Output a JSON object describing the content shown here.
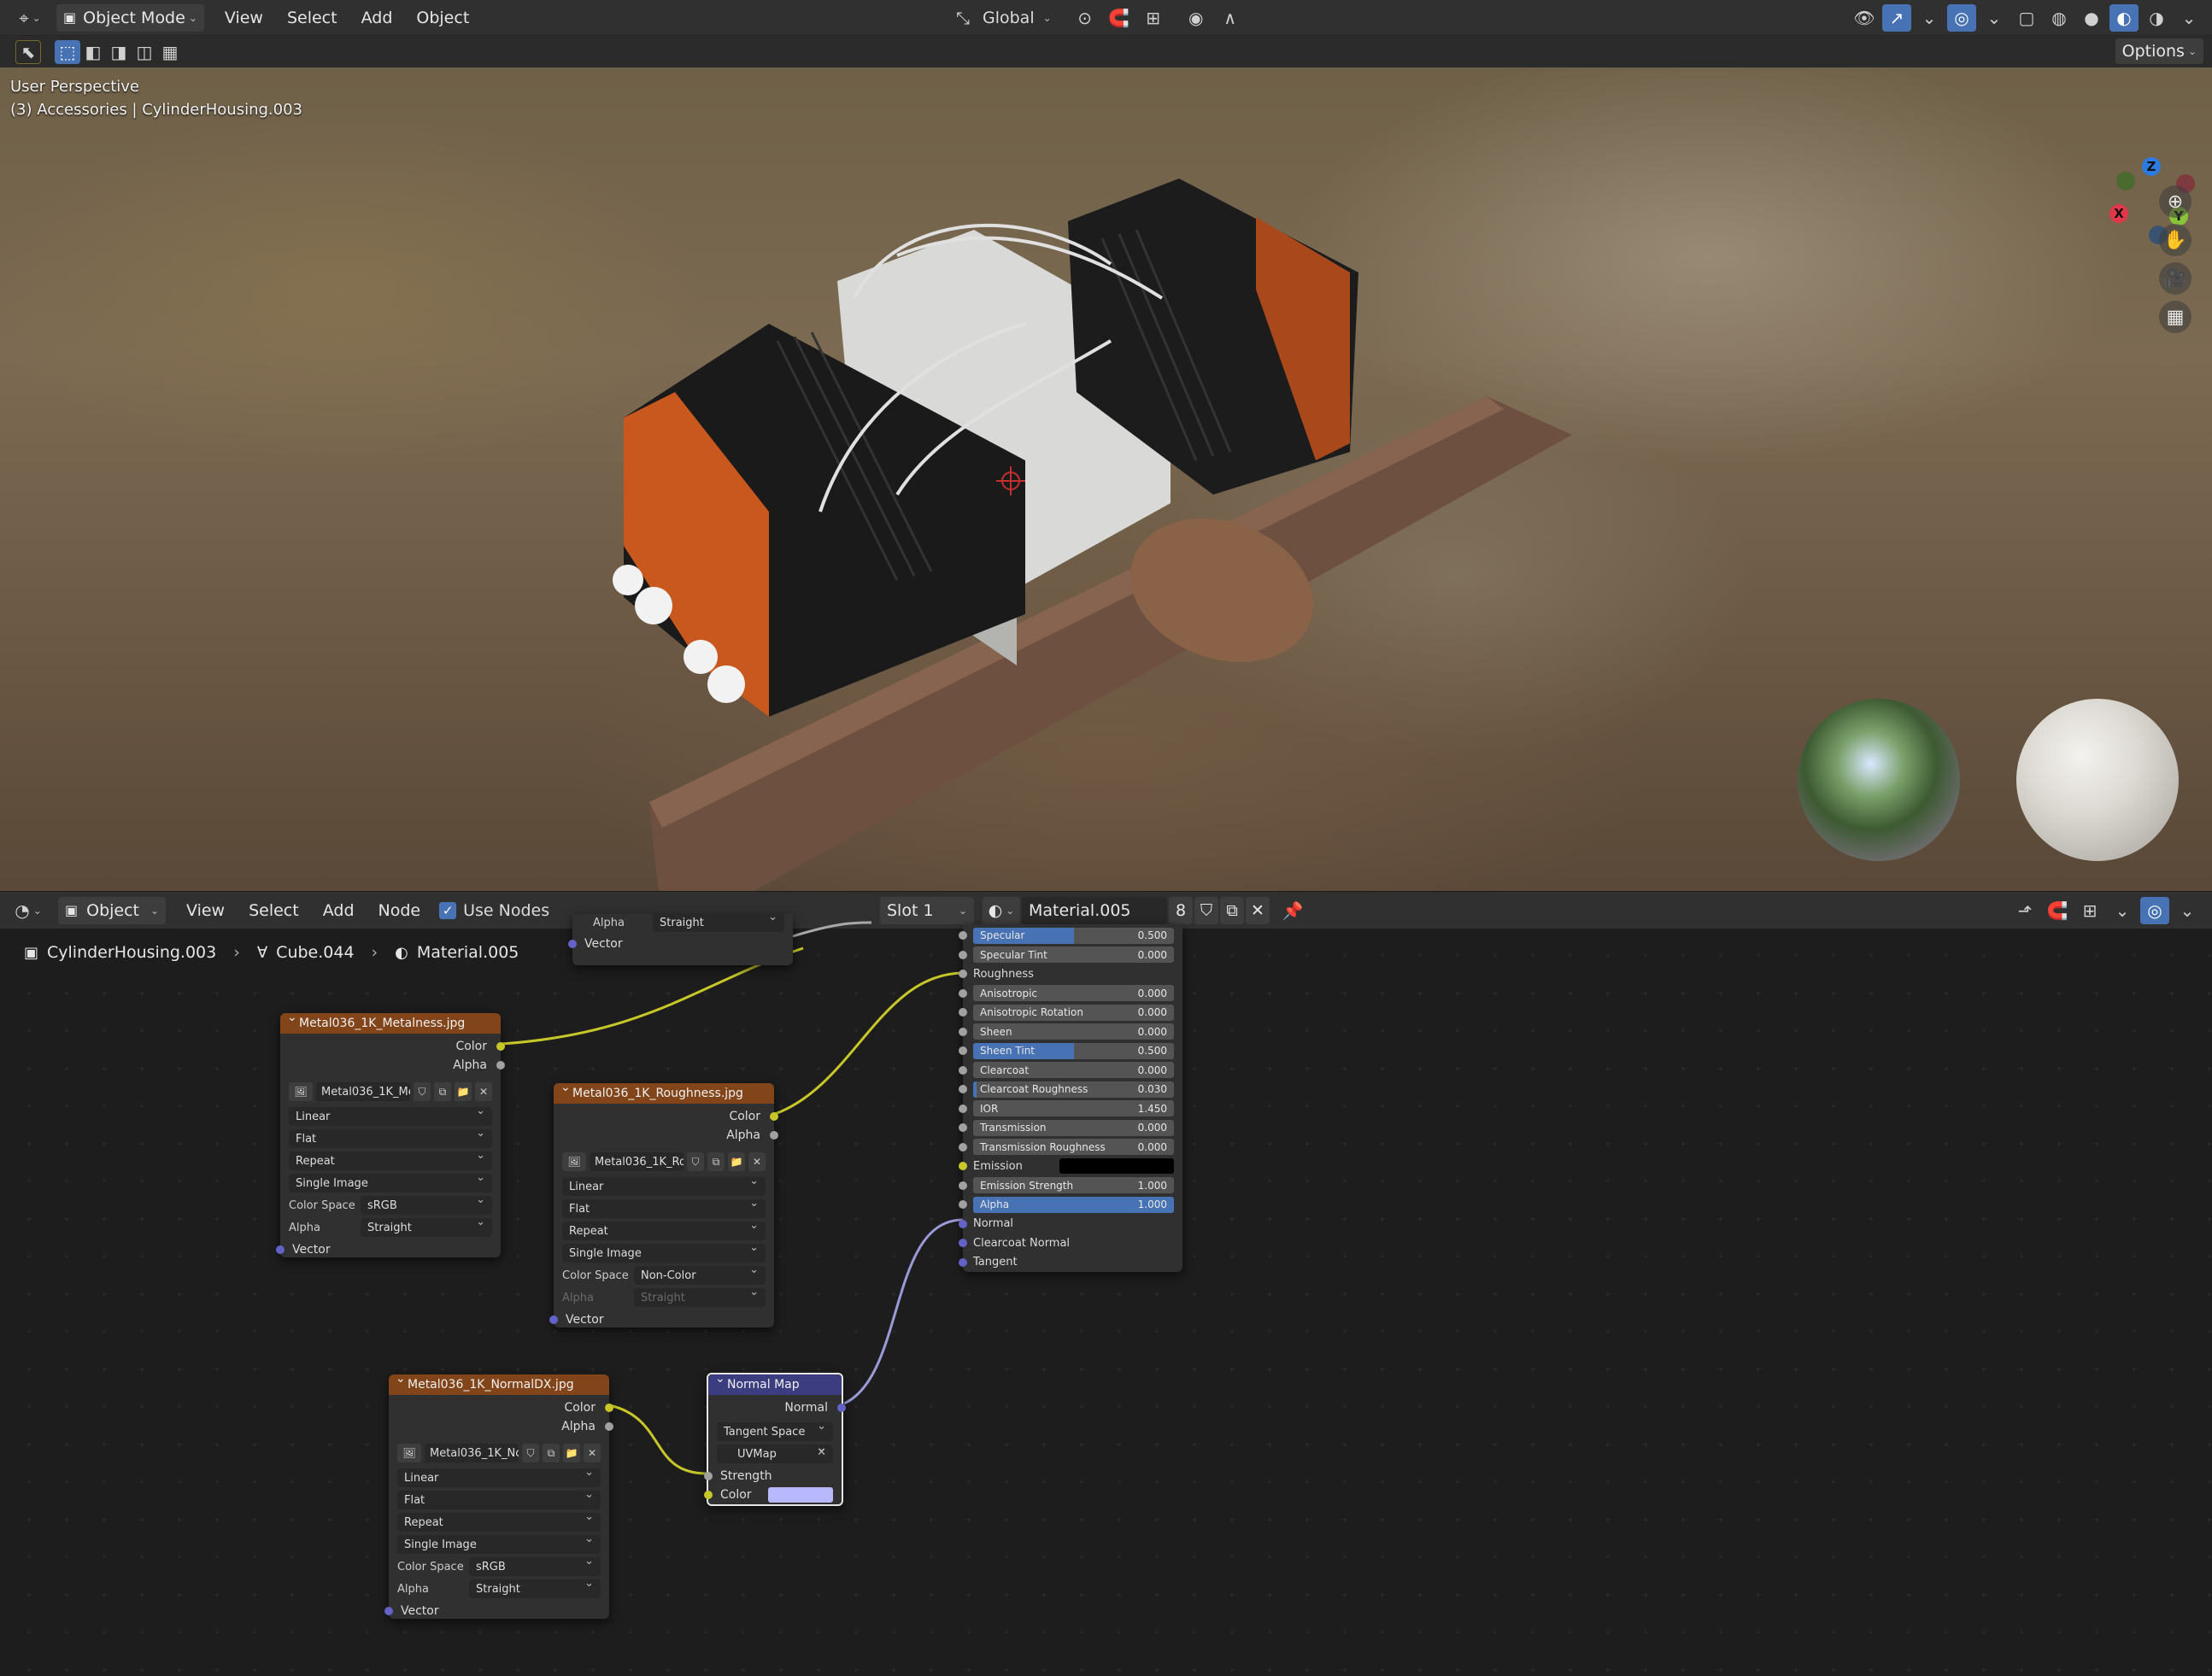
{
  "viewport_header": {
    "mode": "Object Mode",
    "menus": [
      "View",
      "Select",
      "Add",
      "Object"
    ],
    "transform_orientation": "Global",
    "options_label": "Options"
  },
  "viewport": {
    "perspective_label": "User Perspective",
    "object_info": "(3) Accessories | CylinderHousing.003",
    "gizmo": {
      "x": "X",
      "y": "Y",
      "z": "Z"
    }
  },
  "node_header": {
    "editor_type": "Object",
    "menus": [
      "View",
      "Select",
      "Add",
      "Node"
    ],
    "use_nodes_label": "Use Nodes",
    "slot": "Slot 1",
    "material_name": "Material.005",
    "user_count": "8"
  },
  "breadcrumb": {
    "object": "CylinderHousing.003",
    "mesh": "Cube.044",
    "material": "Material.005"
  },
  "partial_node_top": {
    "alpha_label": "Alpha",
    "alpha_value": "Straight",
    "vector_label": "Vector"
  },
  "metalness_node": {
    "title": "Metal036_1K_Metalness.jpg",
    "out_color": "Color",
    "out_alpha": "Alpha",
    "image_name": "Metal036_1K_Met...",
    "interpolation": "Linear",
    "projection": "Flat",
    "extension": "Repeat",
    "source": "Single Image",
    "color_space_label": "Color Space",
    "color_space": "sRGB",
    "alpha_label": "Alpha",
    "alpha": "Straight",
    "vector_label": "Vector"
  },
  "roughness_node": {
    "title": "Metal036_1K_Roughness.jpg",
    "out_color": "Color",
    "out_alpha": "Alpha",
    "image_name": "Metal036_1K_Rou...",
    "interpolation": "Linear",
    "projection": "Flat",
    "extension": "Repeat",
    "source": "Single Image",
    "color_space_label": "Color Space",
    "color_space": "Non-Color",
    "alpha_label": "Alpha",
    "alpha": "Straight",
    "vector_label": "Vector"
  },
  "normal_tex_node": {
    "title": "Metal036_1K_NormalDX.jpg",
    "out_color": "Color",
    "out_alpha": "Alpha",
    "image_name": "Metal036_1K_Nor...",
    "interpolation": "Linear",
    "projection": "Flat",
    "extension": "Repeat",
    "source": "Single Image",
    "color_space_label": "Color Space",
    "color_space": "sRGB",
    "alpha_label": "Alpha",
    "alpha": "Straight",
    "vector_label": "Vector"
  },
  "normal_map_node": {
    "title": "Normal Map",
    "out_normal": "Normal",
    "space": "Tangent Space",
    "uv_map": "UVMap",
    "strength_label": "Strength",
    "color_label": "Color",
    "color_swatch": "#b8b8ff"
  },
  "principled": {
    "rows": [
      {
        "label": "Specular",
        "value": "0.500",
        "fill": 0.5
      },
      {
        "label": "Specular Tint",
        "value": "0.000",
        "fill": 0
      },
      {
        "label": "Roughness",
        "value": null
      },
      {
        "label": "Anisotropic",
        "value": "0.000",
        "fill": 0
      },
      {
        "label": "Anisotropic Rotation",
        "value": "0.000",
        "fill": 0
      },
      {
        "label": "Sheen",
        "value": "0.000",
        "fill": 0
      },
      {
        "label": "Sheen Tint",
        "value": "0.500",
        "fill": 0.5
      },
      {
        "label": "Clearcoat",
        "value": "0.000",
        "fill": 0
      },
      {
        "label": "Clearcoat Roughness",
        "value": "0.030",
        "fill": 0.03
      },
      {
        "label": "IOR",
        "value": "1.450",
        "fill": 0
      },
      {
        "label": "Transmission",
        "value": "0.000",
        "fill": 0
      },
      {
        "label": "Transmission Roughness",
        "value": "0.000",
        "fill": 0
      },
      {
        "label": "Emission",
        "value": null
      },
      {
        "label": "Emission Strength",
        "value": "1.000",
        "fill": 0
      },
      {
        "label": "Alpha",
        "value": "1.000",
        "fill": 1
      },
      {
        "label": "Normal",
        "value": null
      },
      {
        "label": "Clearcoat Normal",
        "value": null
      },
      {
        "label": "Tangent",
        "value": null
      }
    ]
  },
  "colors": {
    "accent": "#4772b3",
    "image_node_header": "#82451a",
    "vector_node_header": "#3c3d80",
    "color_socket": "#c7c729",
    "float_socket": "#a1a1a1",
    "vector_socket": "#6363c7"
  }
}
